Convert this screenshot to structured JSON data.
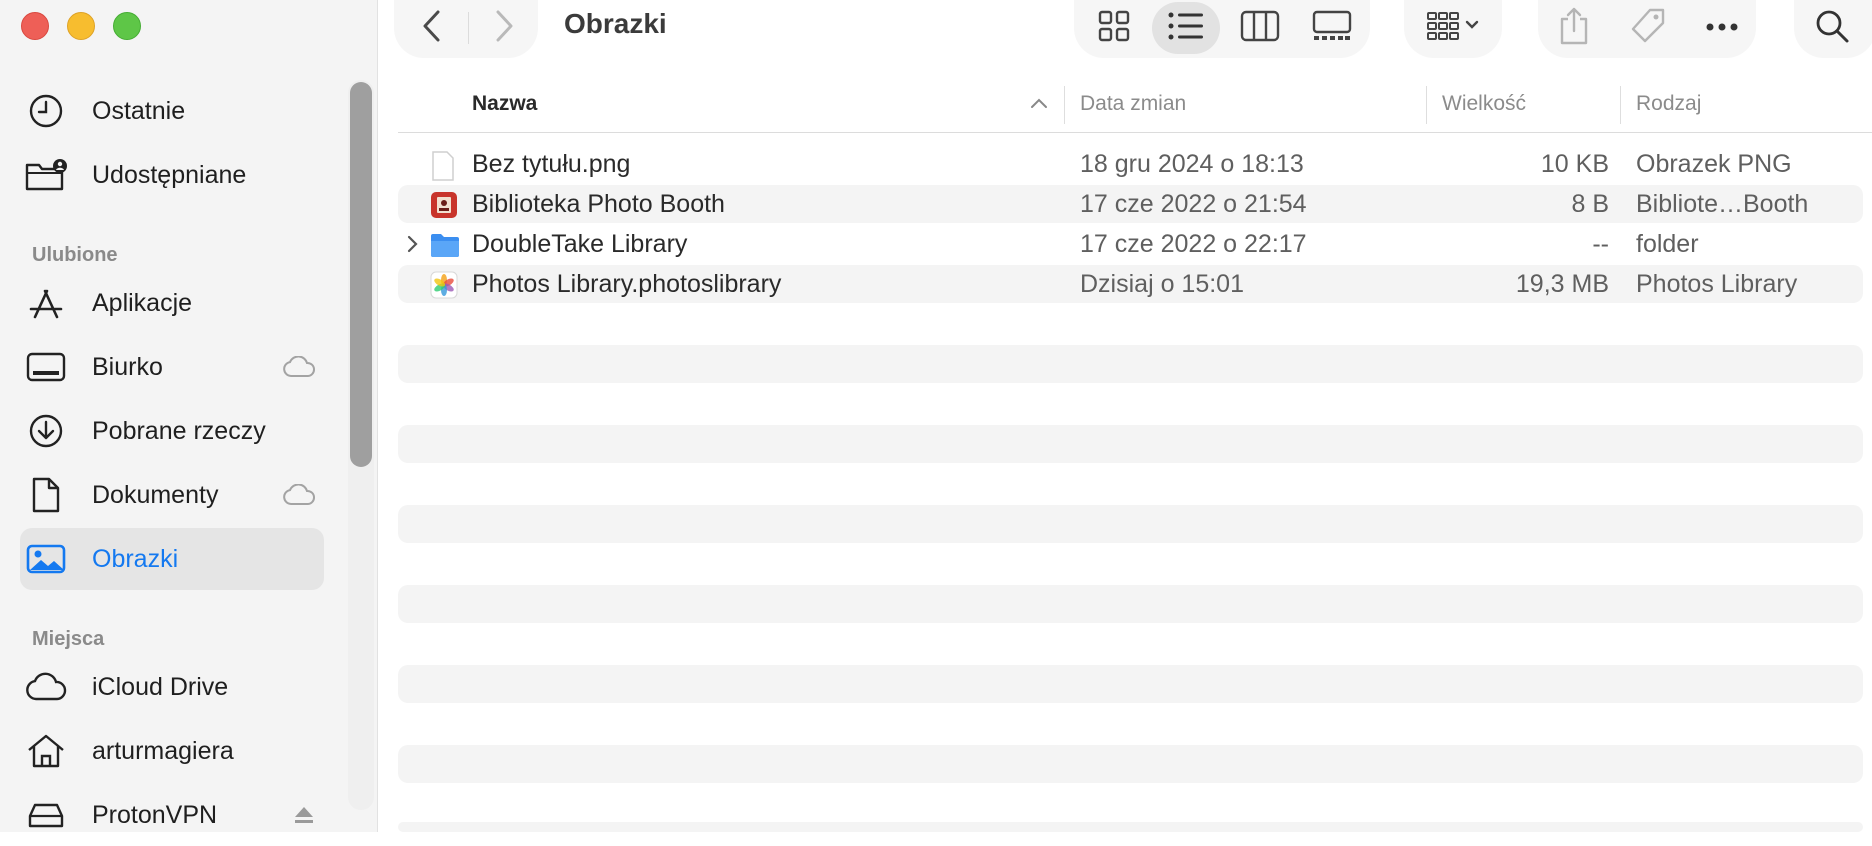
{
  "window": {
    "title": "Obrazki"
  },
  "sidebar": {
    "recents": [
      {
        "label": "Ostatnie",
        "icon": "clock-icon"
      },
      {
        "label": "Udostępniane",
        "icon": "shared-folder-icon"
      }
    ],
    "favorites_header": "Ulubione",
    "favorites": [
      {
        "label": "Aplikacje",
        "icon": "applications-icon"
      },
      {
        "label": "Biurko",
        "icon": "desktop-icon",
        "cloud": true
      },
      {
        "label": "Pobrane rzeczy",
        "icon": "downloads-icon"
      },
      {
        "label": "Dokumenty",
        "icon": "document-icon",
        "cloud": true
      },
      {
        "label": "Obrazki",
        "icon": "pictures-icon",
        "selected": true
      }
    ],
    "locations_header": "Miejsca",
    "locations": [
      {
        "label": "iCloud Drive",
        "icon": "icloud-icon"
      },
      {
        "label": "arturmagiera",
        "icon": "home-icon"
      },
      {
        "label": "ProtonVPN",
        "icon": "drive-icon",
        "ejectable": true
      }
    ]
  },
  "columns": {
    "name": "Nazwa",
    "modified": "Data zmian",
    "size": "Wielkość",
    "kind": "Rodzaj"
  },
  "files": [
    {
      "name": "Bez tytułu.png",
      "modified": "18 gru 2024 o 18:13",
      "size": "10 KB",
      "kind": "Obrazek PNG",
      "icon": "png-file-icon"
    },
    {
      "name": "Biblioteka Photo Booth",
      "modified": "17 cze 2022 o 21:54",
      "size": "8 B",
      "kind": "Bibliote…Booth",
      "icon": "photo-booth-icon"
    },
    {
      "name": "DoubleTake Library",
      "modified": "17 cze 2022 o 22:17",
      "size": "--",
      "kind": "folder",
      "icon": "folder-icon",
      "expandable": true
    },
    {
      "name": "Photos Library.photoslibrary",
      "modified": "Dzisiaj o 15:01",
      "size": "19,3 MB",
      "kind": "Photos Library",
      "icon": "photos-library-icon"
    }
  ],
  "colors": {
    "accent": "#1479f0",
    "sidebar_bg": "#f4f4f4",
    "stripe": "#f4f4f4"
  }
}
